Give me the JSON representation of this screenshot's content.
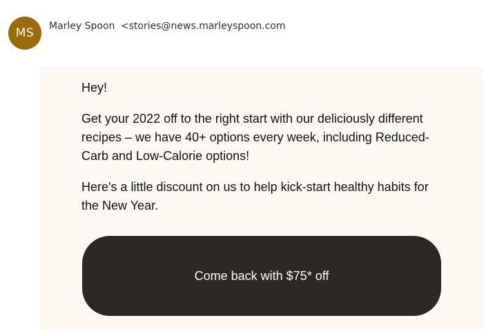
{
  "sender": {
    "initials": "MS",
    "name": "Marley Spoon",
    "email_display": "<stories@news.marleyspoon.com"
  },
  "message": {
    "greeting": "Hey!",
    "paragraph1": "Get your 2022 off to the right start with our deliciously different recipes – we have 40+ options every week, including Reduced-Carb and Low-Calorie options!",
    "paragraph2": "Here's a little discount on us to help kick-start healthy habits for the New Year.",
    "cta_label": "Come back with $75* off"
  },
  "colors": {
    "avatar": "#9a6a0b",
    "panel_background": "#fdf8f1",
    "cta_background": "#2c2724"
  }
}
